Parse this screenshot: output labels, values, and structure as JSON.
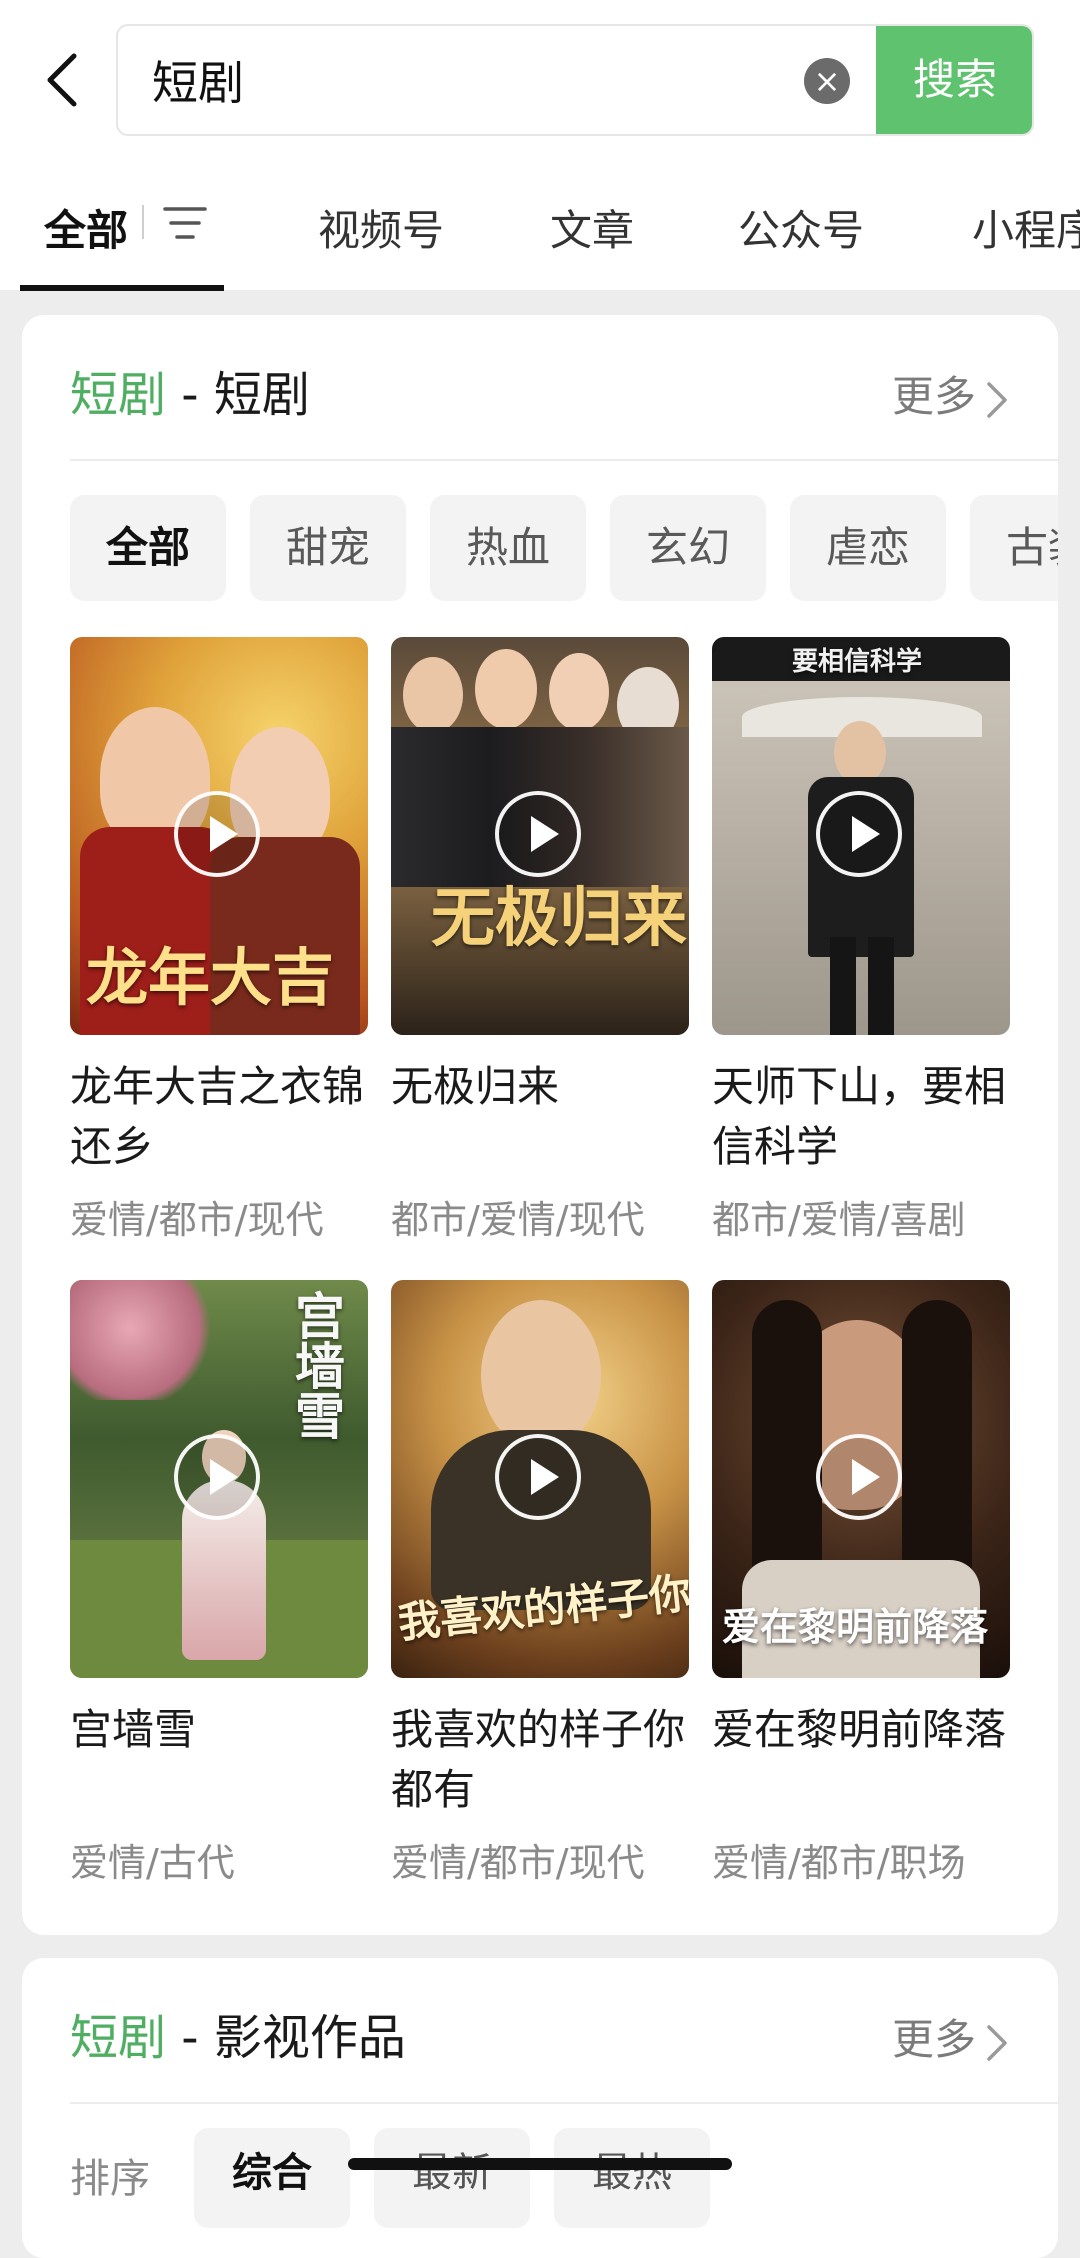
{
  "search": {
    "query": "短剧",
    "button_label": "搜索"
  },
  "tabs": [
    {
      "label": "全部"
    },
    {
      "label": "视频号"
    },
    {
      "label": "文章"
    },
    {
      "label": "公众号"
    },
    {
      "label": "小程序"
    }
  ],
  "section1": {
    "keyword": "短剧",
    "title": " - 短剧",
    "more_label": "更多",
    "chips": [
      "全部",
      "甜宠",
      "热血",
      "玄幻",
      "虐恋",
      "古装"
    ],
    "items": [
      {
        "title": "龙年大吉之衣锦还乡",
        "tags": "爱情/都市/现代",
        "poster_text": "龙年大吉"
      },
      {
        "title": "无极归来",
        "tags": "都市/爱情/现代",
        "poster_text": "无极归来"
      },
      {
        "title": "天师下山，要相信科学",
        "tags": "都市/爱情/喜剧",
        "poster_text": "要相信科学"
      },
      {
        "title": "宫墙雪",
        "tags": "爱情/古代",
        "poster_text": "宫墙雪"
      },
      {
        "title": "我喜欢的样子你都有",
        "tags": "爱情/都市/现代",
        "poster_text": "我喜欢的样子你都有"
      },
      {
        "title": "爱在黎明前降落",
        "tags": "爱情/都市/职场",
        "poster_text": "爱在黎明前降落"
      }
    ]
  },
  "section2": {
    "keyword": "短剧",
    "title": " - 影视作品",
    "more_label": "更多",
    "sort_label": "排序",
    "sort_options": [
      "综合",
      "最新",
      "最热"
    ]
  },
  "colors": {
    "accent_green": "#5ec26e",
    "keyword_green": "#4fae62",
    "background": "#ededed"
  }
}
